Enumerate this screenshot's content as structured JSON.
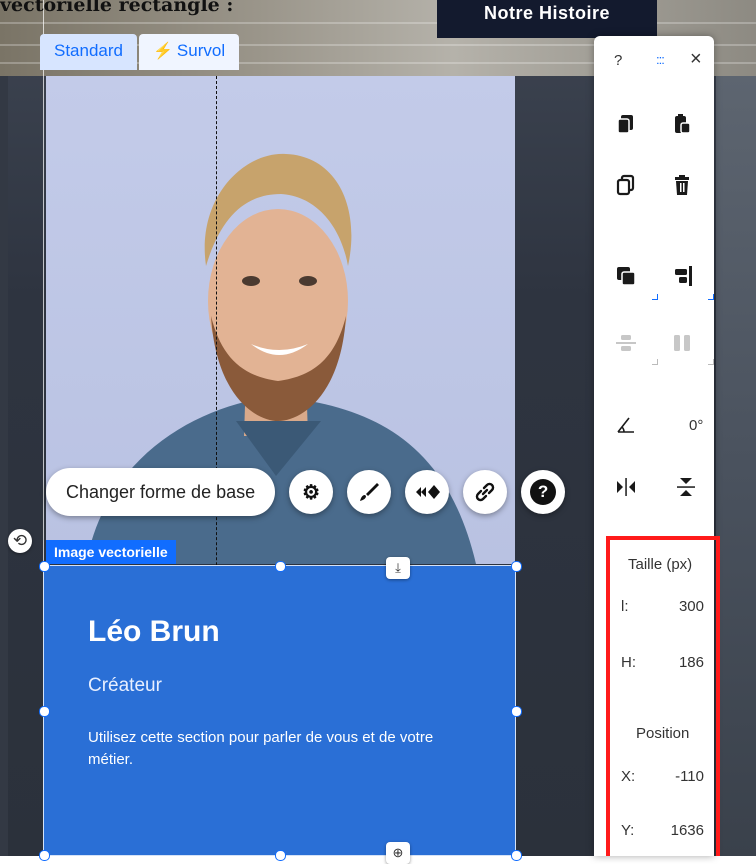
{
  "caption": "vectorielle rectangle :",
  "page": {
    "hero_button": "Notre Histoire"
  },
  "mode_tabs": [
    {
      "label": "Standard"
    },
    {
      "label": "Survol",
      "icon": "lightning-icon"
    }
  ],
  "card": {
    "name": "Léo Brun",
    "role": "Créateur",
    "description": "Utilisez cette section pour parler de vous et de votre métier."
  },
  "floating_toolbar": {
    "change_shape_label": "Changer forme de base",
    "icons": [
      "gear-icon",
      "brush-icon",
      "animation-icon",
      "link-icon",
      "help-icon"
    ]
  },
  "selection_label": "Image vectorielle",
  "side_panel": {
    "header": {
      "help": "?",
      "grip": ":::",
      "close": "×"
    },
    "tools": [
      "copy-icon",
      "paste-icon",
      "duplicate-icon",
      "delete-icon",
      "arrange-icon",
      "align-icon",
      "distribute-icon",
      "match-size-icon",
      "rotate-angle-icon",
      "flip-horizontal-icon",
      "flip-vertical-icon"
    ],
    "rotation_value": "0°",
    "size_title": "Taille (px)",
    "width_label": "l:",
    "width_value": "300",
    "height_label": "H:",
    "height_value": "186",
    "position_title": "Position",
    "x_label": "X:",
    "x_value": "-110",
    "y_label": "Y:",
    "y_value": "1636"
  },
  "colors": {
    "accent": "#116dff",
    "card_blue": "#2a6fd6",
    "highlight": "#ff1a1a",
    "dark_bg": "#2e3440"
  }
}
